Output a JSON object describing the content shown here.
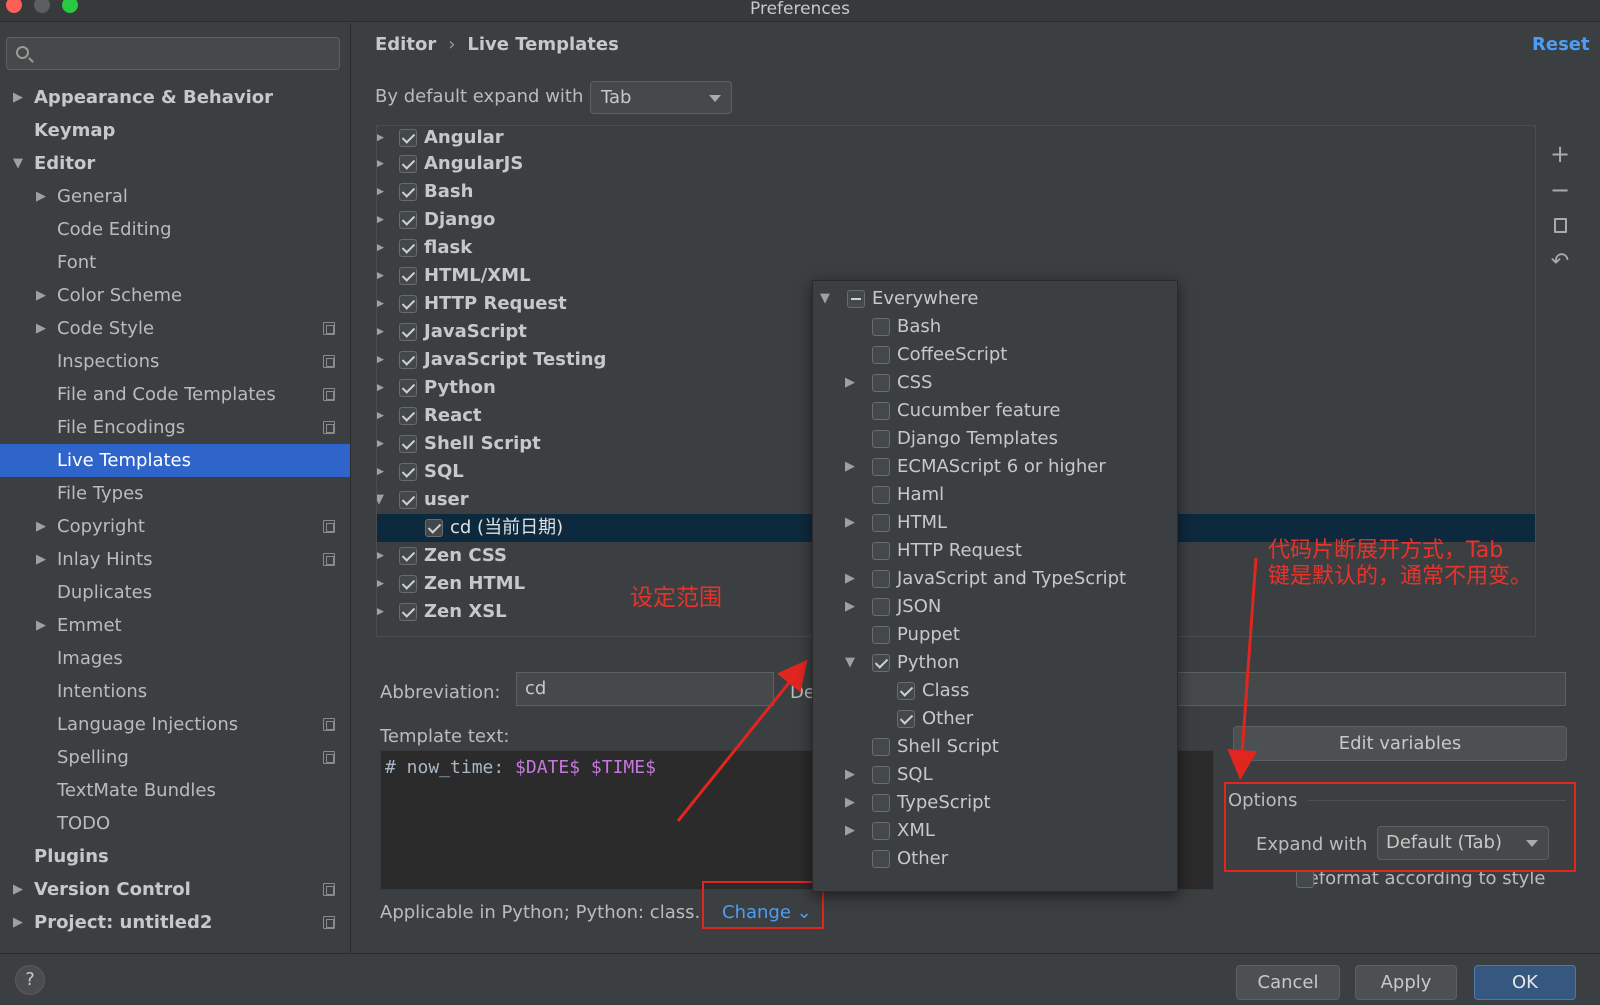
{
  "window": {
    "title": "Preferences"
  },
  "sidebar": {
    "search_placeholder": "",
    "items": [
      {
        "label": "Appearance & Behavior"
      },
      {
        "label": "Keymap"
      },
      {
        "label": "Editor"
      },
      {
        "label": "General"
      },
      {
        "label": "Code Editing"
      },
      {
        "label": "Font"
      },
      {
        "label": "Color Scheme"
      },
      {
        "label": "Code Style"
      },
      {
        "label": "Inspections"
      },
      {
        "label": "File and Code Templates"
      },
      {
        "label": "File Encodings"
      },
      {
        "label": "Live Templates"
      },
      {
        "label": "File Types"
      },
      {
        "label": "Copyright"
      },
      {
        "label": "Inlay Hints"
      },
      {
        "label": "Duplicates"
      },
      {
        "label": "Emmet"
      },
      {
        "label": "Images"
      },
      {
        "label": "Intentions"
      },
      {
        "label": "Language Injections"
      },
      {
        "label": "Spelling"
      },
      {
        "label": "TextMate Bundles"
      },
      {
        "label": "TODO"
      },
      {
        "label": "Plugins"
      },
      {
        "label": "Version Control"
      },
      {
        "label": "Project: untitled2"
      }
    ]
  },
  "header": {
    "crumb_parent": "Editor",
    "crumb_sep": "›",
    "crumb_current": "Live Templates",
    "reset_label": "Reset"
  },
  "expand": {
    "label": "By default expand with",
    "value": "Tab"
  },
  "tree": {
    "groups": [
      {
        "label": "Angular"
      },
      {
        "label": "AngularJS"
      },
      {
        "label": "Bash"
      },
      {
        "label": "Django"
      },
      {
        "label": "flask"
      },
      {
        "label": "HTML/XML"
      },
      {
        "label": "HTTP Request"
      },
      {
        "label": "JavaScript"
      },
      {
        "label": "JavaScript Testing"
      },
      {
        "label": "Python"
      },
      {
        "label": "React"
      },
      {
        "label": "Shell Script"
      },
      {
        "label": "SQL"
      },
      {
        "label": "user"
      },
      {
        "label": "cd (当前日期)"
      },
      {
        "label": "Zen CSS"
      },
      {
        "label": "Zen HTML"
      },
      {
        "label": "Zen XSL"
      }
    ]
  },
  "toolbar": {
    "add_icon": "+",
    "remove_icon": "−",
    "copy_icon": "copy",
    "restore_icon": "↶"
  },
  "annotations": {
    "scope": "设定范围",
    "expand_note_1": "代码片断展开方式，Tab",
    "expand_note_2": "键是默认的，通常不用变。"
  },
  "editor": {
    "abbr_label": "Abbreviation:",
    "abbr_value": "cd",
    "desc_label": "De",
    "template_label": "Template text:",
    "template_prefix": "# now_time: ",
    "template_var1": "$DATE$",
    "template_var2": "$TIME$",
    "edit_vars_label": "Edit variables",
    "options_title": "Options",
    "expand_with_label": "Expand with",
    "expand_with_value": "Default (Tab)",
    "reformat_label": "Reformat according to style",
    "applicable_text": "Applicable in Python; Python: class.",
    "change_label": "Change ⌄"
  },
  "popup": {
    "items": [
      {
        "label": "Everywhere"
      },
      {
        "label": "Bash"
      },
      {
        "label": "CoffeeScript"
      },
      {
        "label": "CSS"
      },
      {
        "label": "Cucumber feature"
      },
      {
        "label": "Django Templates"
      },
      {
        "label": "ECMAScript 6 or higher"
      },
      {
        "label": "Haml"
      },
      {
        "label": "HTML"
      },
      {
        "label": "HTTP Request"
      },
      {
        "label": "JavaScript and TypeScript"
      },
      {
        "label": "JSON"
      },
      {
        "label": "Puppet"
      },
      {
        "label": "Python"
      },
      {
        "label": "Class"
      },
      {
        "label": "Other"
      },
      {
        "label": "Shell Script"
      },
      {
        "label": "SQL"
      },
      {
        "label": "TypeScript"
      },
      {
        "label": "XML"
      },
      {
        "label": "Other"
      }
    ]
  },
  "buttons": {
    "help": "?",
    "cancel": "Cancel",
    "apply": "Apply",
    "ok": "OK"
  },
  "colors": {
    "accent": "#2f65ca",
    "link": "#4a9ff5",
    "annotation": "#e8332a",
    "background": "#3c3f41"
  }
}
